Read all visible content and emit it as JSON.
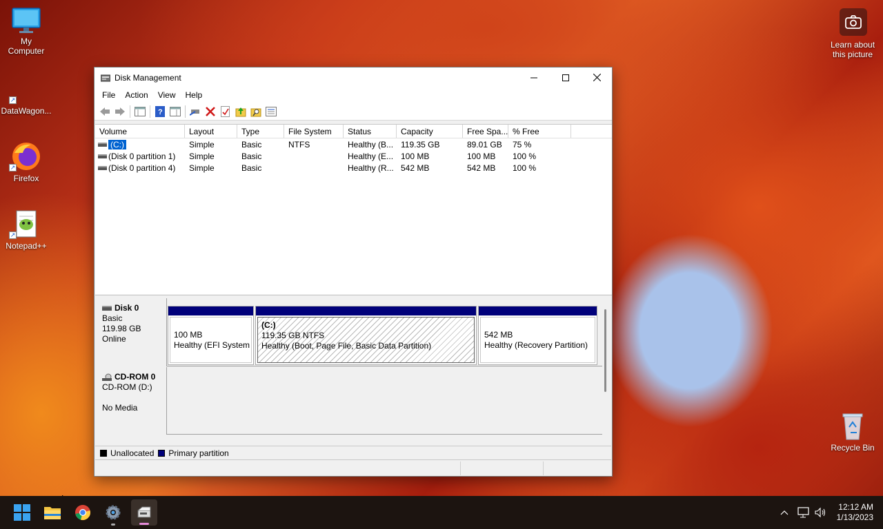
{
  "desktop": {
    "icons": [
      {
        "label_line1": "My",
        "label_line2": "Computer"
      },
      {
        "label": "DataWagon..."
      },
      {
        "label": "Firefox"
      },
      {
        "label": "Notepad++"
      },
      {
        "label": "Recycle Bin"
      }
    ],
    "learn_about_line1": "Learn about",
    "learn_about_line2": "this picture"
  },
  "window": {
    "title": "Disk Management",
    "menu": [
      "File",
      "Action",
      "View",
      "Help"
    ],
    "columns": [
      "Volume",
      "Layout",
      "Type",
      "File System",
      "Status",
      "Capacity",
      "Free Spa...",
      "% Free"
    ],
    "volumes": [
      {
        "volume": "(C:)",
        "layout": "Simple",
        "type": "Basic",
        "fs": "NTFS",
        "status": "Healthy (B...",
        "capacity": "119.35 GB",
        "free": "89.01 GB",
        "pct": "75 %"
      },
      {
        "volume": "(Disk 0 partition 1)",
        "layout": "Simple",
        "type": "Basic",
        "fs": "",
        "status": "Healthy (E...",
        "capacity": "100 MB",
        "free": "100 MB",
        "pct": "100 %"
      },
      {
        "volume": "(Disk 0 partition 4)",
        "layout": "Simple",
        "type": "Basic",
        "fs": "",
        "status": "Healthy (R...",
        "capacity": "542 MB",
        "free": "542 MB",
        "pct": "100 %"
      }
    ],
    "disk0": {
      "name": "Disk 0",
      "type": "Basic",
      "size": "119.98 GB",
      "state": "Online",
      "partitions": [
        {
          "title": "",
          "line1": "100 MB",
          "line2": "Healthy (EFI System P"
        },
        {
          "title": "(C:)",
          "line1": "119.35 GB NTFS",
          "line2": "Healthy (Boot, Page File, Basic Data Partition)"
        },
        {
          "title": "",
          "line1": "542 MB",
          "line2": "Healthy (Recovery Partition)"
        }
      ]
    },
    "cdrom": {
      "name": "CD-ROM 0",
      "type": "CD-ROM (D:)",
      "state": "No Media"
    },
    "legend": {
      "unallocated": "Unallocated",
      "primary": "Primary partition"
    }
  },
  "taskbar": {
    "time": "12:12 AM",
    "date": "1/13/2023"
  },
  "colors": {
    "primary_partition": "#00007a",
    "unallocated": "#000000",
    "selection": "#0063d1"
  }
}
